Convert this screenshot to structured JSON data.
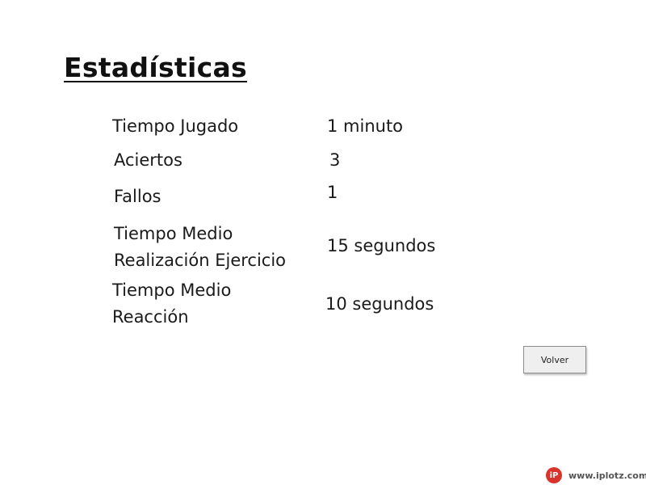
{
  "page": {
    "title": "Estadísticas"
  },
  "stats": [
    {
      "label": "Tiempo Jugado",
      "value": "1 minuto"
    },
    {
      "label": "Aciertos",
      "value": "3"
    },
    {
      "label": "Fallos",
      "value": "1"
    },
    {
      "label": "Tiempo Medio Realización Ejercicio",
      "value": "15 segundos"
    },
    {
      "label": "Tiempo Medio Reacción",
      "value": "10 segundos"
    }
  ],
  "actions": {
    "back_label": "Volver"
  },
  "watermark": {
    "logo_text": "iP",
    "url": "www.iplotz.com",
    "logo_color": "#d9342b"
  }
}
